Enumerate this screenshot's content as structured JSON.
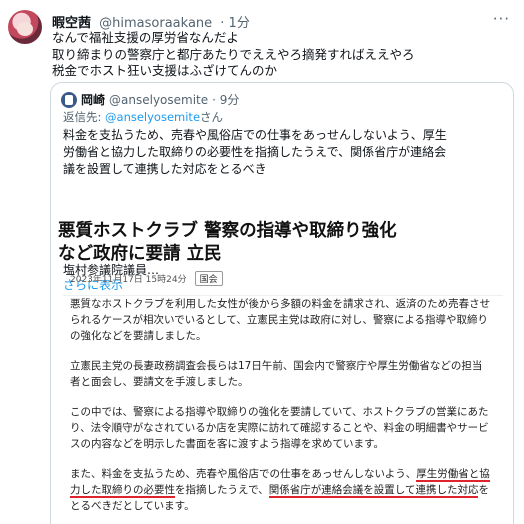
{
  "tweet": {
    "name": "暇空茜",
    "handle": "@himasoraakane",
    "time": "· 1分",
    "lines": [
      "なんで福祉支援の厚労省なんだよ",
      "取り締まりの警察庁と都庁あたりでええやろ摘発すればええやろ",
      "税金でホスト狂い支援はふざけてんのか"
    ]
  },
  "quote": {
    "name": "岡崎",
    "handle": "@anselyosemite",
    "time": "· 9分",
    "reply_prefix": "返信先:",
    "reply_handle": "@anselyosemite",
    "reply_suffix": "さん",
    "lines": [
      "料金を支払うため、売春や風俗店での仕事をあっせんしないよう、厚生",
      "労働省と協力した取締りの必要性を指摘したうえで、関係省庁が連絡会",
      "議を設置して連携した対応をとるべき"
    ],
    "author": "塩村参議院議員…",
    "show_more": "さらに表示"
  },
  "article": {
    "title_lines": [
      "悪質ホストクラブ 警察の指導や取締り強化",
      "など政府に要請 立民"
    ],
    "date": "2023年11月17日 15時24分",
    "tag": "国会",
    "p1": [
      "悪質なホストクラブを利用した女性が後から多額の料金を請求され、返済のため売春させ",
      "られるケースが相次いでいるとして、立憲民主党は政府に対し、警察による指導や取締り",
      "の強化などを要請しました。"
    ],
    "p2": [
      "立憲民主党の長妻政務調査会長らは17日午前、国会内で警察庁や厚生労働省などの担当",
      "者と面会し、要請文を手渡しました。"
    ],
    "p3": [
      "この中では、警察による指導や取締りの強化を要請していて、ホストクラブの営業にあた",
      "り、法令順守がなされているか店を実際に訪れて確認することや、料金の明細書やサービ",
      "スの内容などを明示した書面を客に渡すよう指導を求めています。"
    ],
    "p4a_1": "また、料金を支払うため、売春や風俗店での仕事をあっせんしないよう、",
    "p4a_hl": "厚生労働省と協",
    "p4b_hl1": "力した取締りの必要性",
    "p4b_mid": "を指摘したうえで、",
    "p4b_hl2": "関係省庁が連絡会議を設置して連携した対応",
    "p4b_end": "を",
    "p4c": "とるべきだとしています。"
  }
}
